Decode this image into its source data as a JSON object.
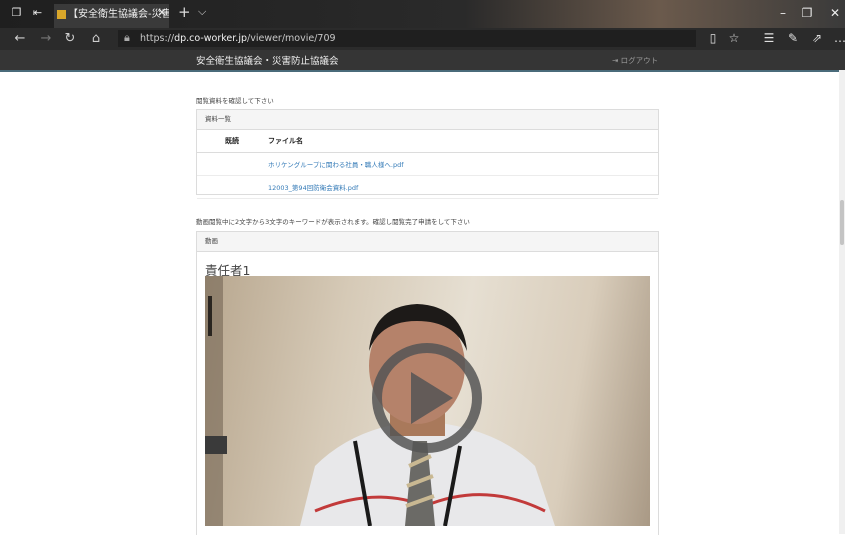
{
  "browser": {
    "tab_title": "【安全衛生協議会-災害I",
    "tab_close": "×",
    "new_tab": "+",
    "tab_list": "⌵",
    "url_prefix": "https://",
    "url_domain": "dp.co-worker.jp",
    "url_path": "/viewer/movie/709"
  },
  "site": {
    "title": "安全衛生協議会・災害防止協議会",
    "logout": "⇥ ログアウト"
  },
  "instructions": {
    "documents": "閲覧資料を確認して下さい",
    "video": "動画閲覧中に2文字から3文字のキーワードが表示されます。確認し閲覧完了申請をして下さい"
  },
  "documents_panel": {
    "heading": "資料一覧",
    "columns": [
      "既読",
      "ファイル名"
    ],
    "files": [
      {
        "read": "",
        "name": "ホリケングループに関わる社員・職人様へ.pdf"
      },
      {
        "read": "",
        "name": "12003_第94回防衛会資料.pdf"
      }
    ]
  },
  "video_panel": {
    "heading": "動画",
    "title": "責任者1"
  }
}
